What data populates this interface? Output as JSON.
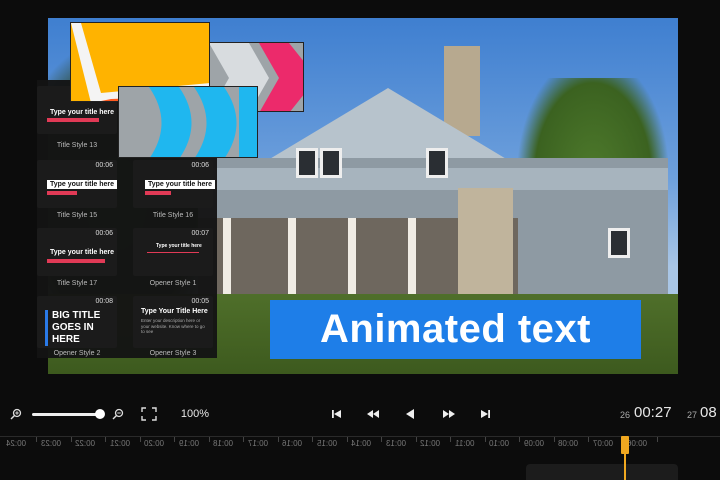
{
  "preview": {
    "banner_text": "Animated text"
  },
  "templates": [
    {
      "title": "Type your title here",
      "label": "Title Style 13",
      "duration": ""
    },
    {
      "title": "Type your title here",
      "label": "Title Style 15",
      "duration": "00:06"
    },
    {
      "title": "Type your title here",
      "label": "Title Style 16",
      "duration": "00:06"
    },
    {
      "title": "Type your title here",
      "label": "Title Style 17",
      "duration": "00:06"
    },
    {
      "title": "Type your title here",
      "label": "Opener Style 1",
      "duration": "00:07"
    },
    {
      "title": "BIG TITLE GOES IN HERE",
      "label": "Opener Style 2",
      "duration": "00:08"
    },
    {
      "title": "Type Your Title Here",
      "label": "Opener Style 3",
      "duration": "00:05",
      "desc": "Enter your description here or your website. Know where to go to see"
    }
  ],
  "toolbar": {
    "zoom_percent": "100%",
    "zoom_level": 0.95,
    "current_time": "00:27",
    "current_frame": "26",
    "total_time": "08",
    "total_frame": "27"
  },
  "ruler": {
    "ticks": [
      "00:24",
      "00:23",
      "00:22",
      "00:21",
      "00:20",
      "00:19",
      "00:18",
      "00:17",
      "00:16",
      "00:15",
      "00:14",
      "00:13",
      "00:12",
      "00:11",
      "00:10",
      "00:09",
      "00:08",
      "00:07",
      "00:06"
    ]
  },
  "colors": {
    "banner": "#1e7ee8",
    "playhead": "#f0a820",
    "accent_red": "#e13a56"
  }
}
